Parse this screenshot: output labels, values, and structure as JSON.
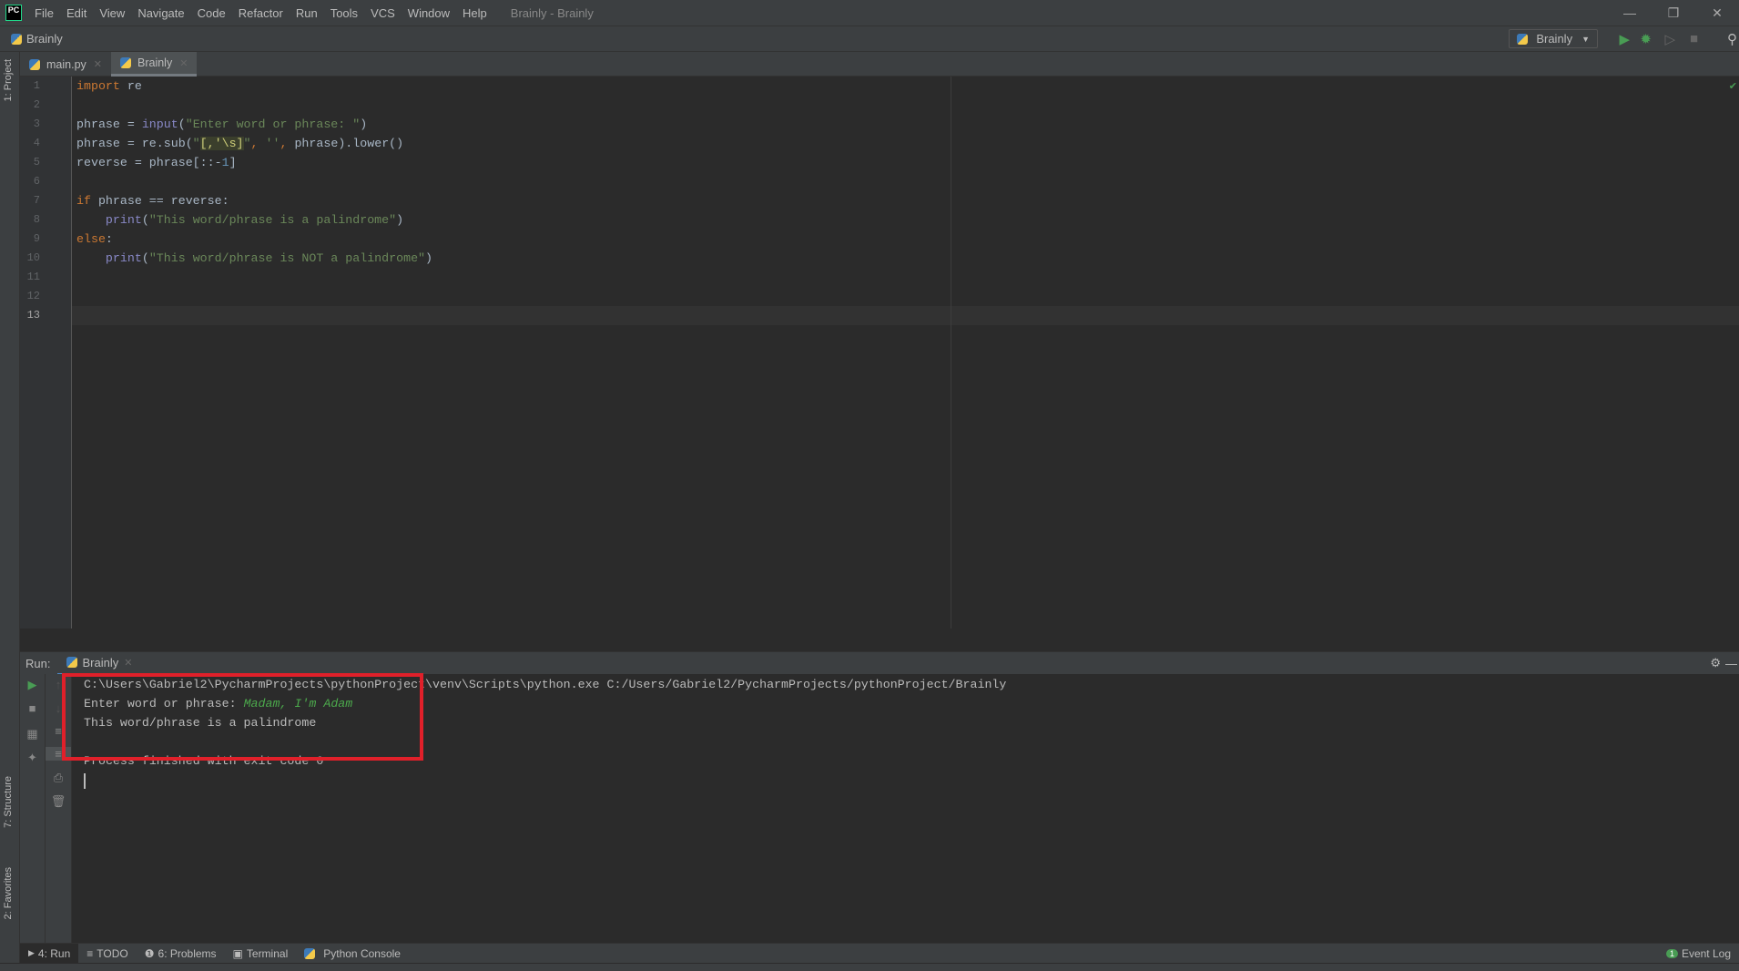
{
  "titlebar": {
    "logo": "PC",
    "menu": [
      "File",
      "Edit",
      "View",
      "Navigate",
      "Code",
      "Refactor",
      "Run",
      "Tools",
      "VCS",
      "Window",
      "Help"
    ],
    "title": "Brainly - Brainly"
  },
  "navbar": {
    "project": "Brainly",
    "run_config": "Brainly"
  },
  "left_strip": {
    "project": "1: Project",
    "structure": "7: Structure",
    "favorites": "2: Favorites"
  },
  "tabs": [
    {
      "label": "main.py",
      "active": false
    },
    {
      "label": "Brainly",
      "active": true
    }
  ],
  "editor": {
    "line_numbers": [
      "1",
      "2",
      "3",
      "4",
      "5",
      "6",
      "7",
      "8",
      "9",
      "10",
      "11",
      "12",
      "13"
    ],
    "current_line": 13
  },
  "run": {
    "label": "Run:",
    "tab": "Brainly",
    "console": {
      "command": "C:\\Users\\Gabriel2\\PycharmProjects\\pythonProject\\venv\\Scripts\\python.exe C:/Users/Gabriel2/PycharmProjects/pythonProject/Brainly",
      "prompt": "Enter word or phrase: ",
      "user_input": "Madam, I'm Adam",
      "result": "This word/phrase is a palindrome",
      "exit": "Process finished with exit code 0"
    }
  },
  "bottom_tools": [
    {
      "label": "4: Run"
    },
    {
      "label": "TODO"
    },
    {
      "label": "6: Problems"
    },
    {
      "label": "Terminal"
    },
    {
      "label": "Python Console"
    }
  ],
  "event_log": {
    "count": "1",
    "label": "Event Log"
  },
  "colors": {
    "highlight_box": "#e0202a",
    "keyword": "#cc7832",
    "string": "#6a8759",
    "input": "#4caa4c"
  }
}
